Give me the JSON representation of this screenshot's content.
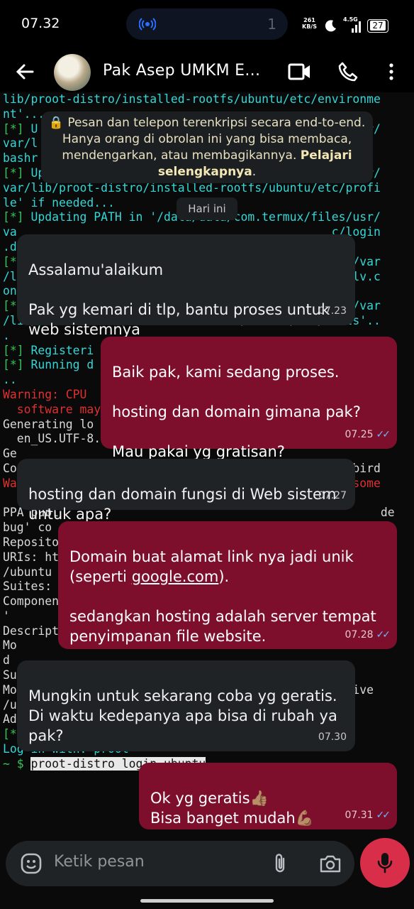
{
  "status_bar": {
    "time": "07.32",
    "notification_count": "1",
    "net_speed_value": "261",
    "net_speed_unit": "KB/S",
    "signal_label": "4.5G",
    "battery": "27"
  },
  "header": {
    "contact_name": "Pak Asep UMKM E...",
    "icons": [
      "back-arrow-icon",
      "video-call-icon",
      "phone-icon",
      "more-vert-icon"
    ]
  },
  "notice": {
    "text": "Pesan dan telepon terenkripsi secara end-to-end. Hanya orang di obrolan ini yang bisa membaca, mendengarkan, atau membagikannya.",
    "link": "Pelajari selengkapnya"
  },
  "date_chip": "Hari ini",
  "messages": [
    {
      "direction": "in",
      "text": "Assalamu'alaikum\n\nPak yg kemari di tlp, bantu proses untuk web sistemnya",
      "time": "07.23"
    },
    {
      "direction": "out",
      "text": "Baik pak, kami sedang proses.\n\nhosting dan domain gimana pak?\n\nMau pakai yg gratisan?",
      "time": "07.25"
    },
    {
      "direction": "in",
      "text": "hosting dan domain fungsi di Web sistem untuk apa?",
      "time": "07.27"
    },
    {
      "direction": "out",
      "text_before": "Domain buat alamat link nya jadi unik (seperti ",
      "link": "google.com",
      "text_after": ").\n\nsedangkan hosting adalah server tempat penyimpanan file website.",
      "time": "07.28"
    },
    {
      "direction": "in",
      "text": "Mungkin untuk sekarang coba yg geratis.\nDi waktu kedepanya apa bisa di rubah ya pak?",
      "time": "07.30"
    },
    {
      "direction": "out",
      "text": "Ok yg geratis👍🏽\nBisa banget mudah💪🏽",
      "time": "07.31"
    }
  ],
  "input": {
    "placeholder": "Ketik pesan"
  },
  "wallpaper_terminal": [
    "lib/proot-distro/installed-rootfs/ubuntu/etc/environme",
    "nt'...",
    "[*] U                                            /usr/",
    "var/l                                          bash.",
    "bashr",
    "[*] Updating PATH in '/data/data/com.termux/files/usr/",
    "var/lib/proot-distro/installed-rootfs/ubuntu/etc/profi",
    "le' if needed...",
    "[*] Updating PATH in '/data/data/com.termux/files/usr/",
    "va                                             c/login",
    ".d",
    "[*                                            /usr/var",
    "/l                                            resolv.c",
    "on",
    "[*                                            /usr/var",
    "/lib/proot-distro/installed-rootfs/ubuntu/etc/hosts'..",
    ".",
    "[*] Registeri",
    "[*] Running d                                        s.",
    "..",
    "Warning: CPU                                         me",
    "  software may",
    "Generating lo",
    "  en_US.UTF-8... done",
    "Ge",
    "Co                                            nderbird",
    "",
    "Warning: CPU doesn't support 32-bit instructions, some",
    "  software may not work.",
    "PPA publ                                              de",
    "bug' co",
    "Reposito",
    "URIs: ht                                              pa",
    "/ubuntu",
    "Suites:",
    "Componen",
    "'",
    "Description:",
    "Mo                                            nderbir",
    "d",
    "",
    "Su",
    "Mo                                            archive",
    "/u",
    "Adding repository.",
    "[*] Finished.",
    "",
    "Log in with: proot",
    "",
    "~ $ proot-distro login ubuntu"
  ]
}
